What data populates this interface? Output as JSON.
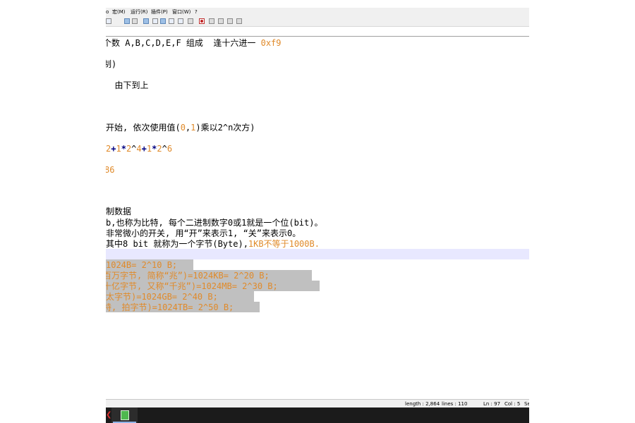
{
  "menubar": {
    "items": [
      "o",
      "宏(M)",
      "运行(R)",
      "插件(P)",
      "窗口(W)",
      "?"
    ]
  },
  "editor": {
    "lines": [
      {
        "parts": [
          {
            "t": "个数 A,B,C,D,E,F 组成  逢十六进一 ",
            "c": "txt"
          },
          {
            "t": "0xf9",
            "c": "num"
          }
        ]
      },
      {
        "parts": [
          {
            "t": "制)",
            "c": "txt"
          }
        ]
      },
      {
        "parts": [
          {
            "t": "  由下到上",
            "c": "txt"
          }
        ]
      },
      {
        "parts": [
          {
            "t": "开始, 依次使用值(",
            "c": "txt"
          },
          {
            "t": "0",
            "c": "num"
          },
          {
            "t": ",",
            "c": "txt"
          },
          {
            "t": "1",
            "c": "num"
          },
          {
            "t": ")乘以2^n次方)",
            "c": "txt"
          }
        ]
      },
      {
        "parts": [
          {
            "t": "2",
            "c": "num"
          },
          {
            "t": "+",
            "c": "op"
          },
          {
            "t": "1",
            "c": "num"
          },
          {
            "t": "*",
            "c": "op"
          },
          {
            "t": "2",
            "c": "num"
          },
          {
            "t": "^",
            "c": "txt"
          },
          {
            "t": "4",
            "c": "num"
          },
          {
            "t": "+",
            "c": "op"
          },
          {
            "t": "1",
            "c": "num"
          },
          {
            "t": "*",
            "c": "op"
          },
          {
            "t": "2",
            "c": "num"
          },
          {
            "t": "^",
            "c": "txt"
          },
          {
            "t": "6",
            "c": "num"
          }
        ]
      },
      {
        "parts": [
          {
            "t": "86",
            "c": "num"
          }
        ]
      },
      {
        "parts": [
          {
            "t": "制数据",
            "c": "txt"
          }
        ]
      },
      {
        "parts": [
          {
            "t": "b,也称为比特, 每个二进制数字0或1就是一个位(bit)。",
            "c": "txt"
          }
        ]
      },
      {
        "parts": [
          {
            "t": "非常微小的开关, 用“开”来表示1, “关”来表示0。",
            "c": "txt"
          }
        ]
      },
      {
        "parts": [
          {
            "t": "其中8 bit 就称为一个字节(Byte),",
            "c": "txt"
          },
          {
            "t": "1KB不等于1000B.",
            "c": "num"
          }
        ]
      },
      {
        "parts": [
          {
            "t": "1024B= 2^10 B;",
            "c": "sel"
          }
        ]
      },
      {
        "parts": [
          {
            "t": "百万字节, 简称“兆”)=1024KB= 2^20 B;",
            "c": "sel"
          }
        ]
      },
      {
        "parts": [
          {
            "t": "十亿字节, 又称“千兆”)=1024MB= 2^30 B;",
            "c": "sel"
          }
        ]
      },
      {
        "parts": [
          {
            "t": "太字节)=1024GB= 2^40 B;",
            "c": "sel"
          }
        ]
      },
      {
        "parts": [
          {
            "t": "特, 拍字节)=1024TB= 2^50 B;",
            "c": "sel"
          }
        ]
      }
    ]
  },
  "statusbar": {
    "length": "length : 2,864",
    "lines": "lines : 110",
    "ln": "Ln : 97",
    "col": "Col : 5",
    "extra": "Se"
  }
}
